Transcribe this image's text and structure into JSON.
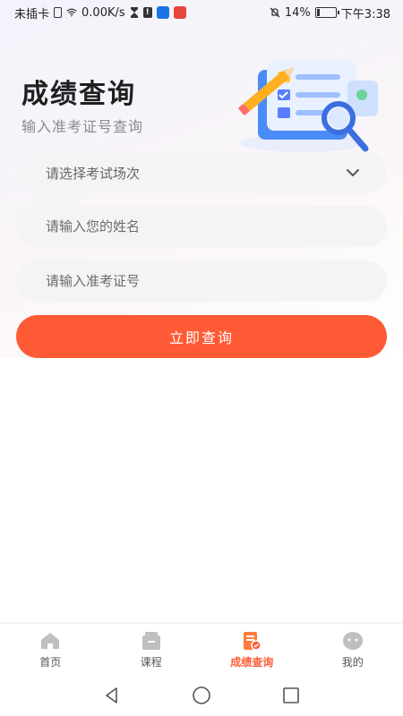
{
  "status_bar": {
    "carrier": "未插卡",
    "speed": "0.00K/s",
    "battery": "14%",
    "battery_level": 0.14,
    "time": "下午3:38"
  },
  "header": {
    "title": "成绩查询",
    "subtitle": "输入准考证号查询"
  },
  "form": {
    "exam_select_placeholder": "请选择考试场次",
    "name_placeholder": "请输入您的姓名",
    "ticket_placeholder": "请输入准考证号",
    "submit_label": "立即查询"
  },
  "tabs": [
    {
      "label": "首页",
      "icon": "home-icon",
      "active": false
    },
    {
      "label": "课程",
      "icon": "course-icon",
      "active": false
    },
    {
      "label": "成绩查询",
      "icon": "score-query-icon",
      "active": true
    },
    {
      "label": "我的",
      "icon": "profile-icon",
      "active": false
    }
  ],
  "colors": {
    "accent": "#ff5a36",
    "input_bg": "#f4f4f6",
    "tab_inactive": "#bfbfbf"
  }
}
